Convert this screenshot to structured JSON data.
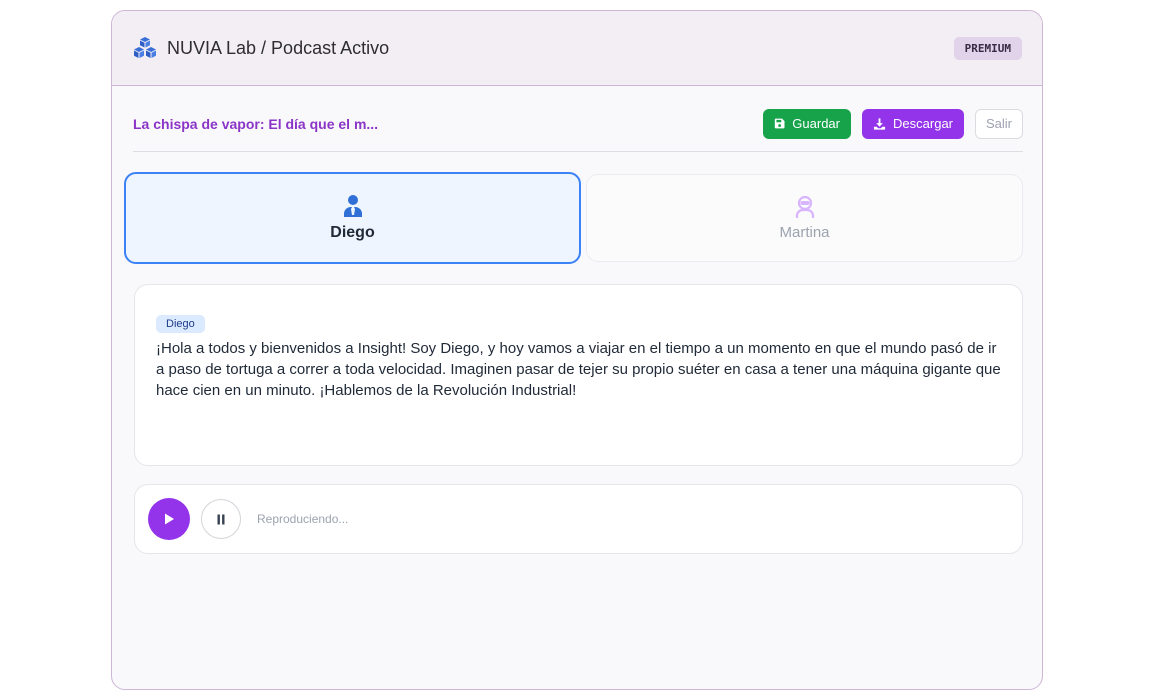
{
  "header": {
    "title": "NUVIA Lab / Podcast Activo",
    "badge": "PREMIUM",
    "icon": "cubes-icon"
  },
  "toolbar": {
    "episode_title": "La chispa de vapor: El día que el m...",
    "save_label": "Guardar",
    "download_label": "Descargar",
    "exit_label": "Salir"
  },
  "speakers": [
    {
      "name": "Diego",
      "icon": "user-tie-icon",
      "active": true
    },
    {
      "name": "Martina",
      "icon": "user-astronaut-icon",
      "active": false
    }
  ],
  "transcript": {
    "speaker_tag": "Diego",
    "text": "¡Hola a todos y bienvenidos a Insight! Soy Diego, y hoy vamos a viajar en el tiempo a un momento en que el mundo pasó de ir a paso de tortuga a correr a toda velocidad. Imaginen pasar de tejer su propio suéter en casa a tener una máquina gigante que hace cien en un minuto. ¡Hablemos de la Revolución Industrial!"
  },
  "player": {
    "status": "Reproduciendo..."
  },
  "colors": {
    "accent_purple": "#9333ea",
    "save_green": "#16a34a",
    "active_blue": "#3b82f6"
  }
}
